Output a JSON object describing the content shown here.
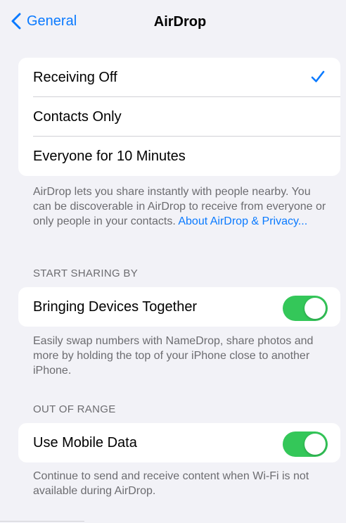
{
  "nav": {
    "back_label": "General",
    "title": "AirDrop"
  },
  "receiving": {
    "options": [
      {
        "label": "Receiving Off",
        "selected": true
      },
      {
        "label": "Contacts Only",
        "selected": false
      },
      {
        "label": "Everyone for 10 Minutes",
        "selected": false
      }
    ],
    "footer_text": "AirDrop lets you share instantly with people nearby. You can be discoverable in AirDrop to receive from everyone or only people in your contacts.",
    "footer_link": "About AirDrop & Privacy..."
  },
  "start_sharing": {
    "header": "START SHARING BY",
    "row_label": "Bringing Devices Together",
    "toggle_on": true,
    "footer_text": "Easily swap numbers with NameDrop, share photos and more by holding the top of your iPhone close to another iPhone."
  },
  "out_of_range": {
    "header": "OUT OF RANGE",
    "row_label": "Use Mobile Data",
    "toggle_on": true,
    "footer_text": "Continue to send and receive content when Wi-Fi is not available during AirDrop."
  },
  "colors": {
    "accent": "#0a7aff",
    "toggle_on": "#34c759",
    "background": "#f2f2f7",
    "secondary_text": "#6c6c70"
  }
}
